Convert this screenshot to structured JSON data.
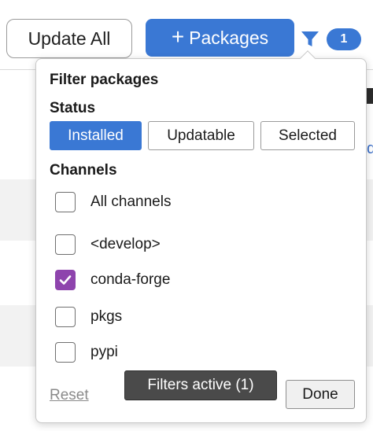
{
  "toolbar": {
    "update_all_label": "Update All",
    "packages_plus": "+",
    "packages_label": "Packages",
    "filter_count": "1"
  },
  "filter_popover": {
    "title": "Filter packages",
    "status_heading": "Status",
    "status_options": [
      {
        "label": "Installed",
        "active": true
      },
      {
        "label": "Updatable",
        "active": false
      },
      {
        "label": "Selected",
        "active": false
      }
    ],
    "channels_heading": "Channels",
    "channels": [
      {
        "label": "All channels",
        "checked": false
      },
      {
        "label": "<develop>",
        "checked": false
      },
      {
        "label": "conda-forge",
        "checked": true
      },
      {
        "label": "pkgs",
        "checked": false
      },
      {
        "label": "pypi",
        "checked": false
      }
    ],
    "reset_label": "Reset",
    "done_label": "Done"
  },
  "tooltip": {
    "text": "Filters active (1)"
  },
  "colors": {
    "accent": "#3a78d4",
    "checkbox_checked": "#8e44ad",
    "tooltip_bg": "#4a4a4a"
  },
  "icons": {
    "filter": "funnel-icon",
    "check": "checkmark-icon",
    "add": "plus-icon"
  }
}
